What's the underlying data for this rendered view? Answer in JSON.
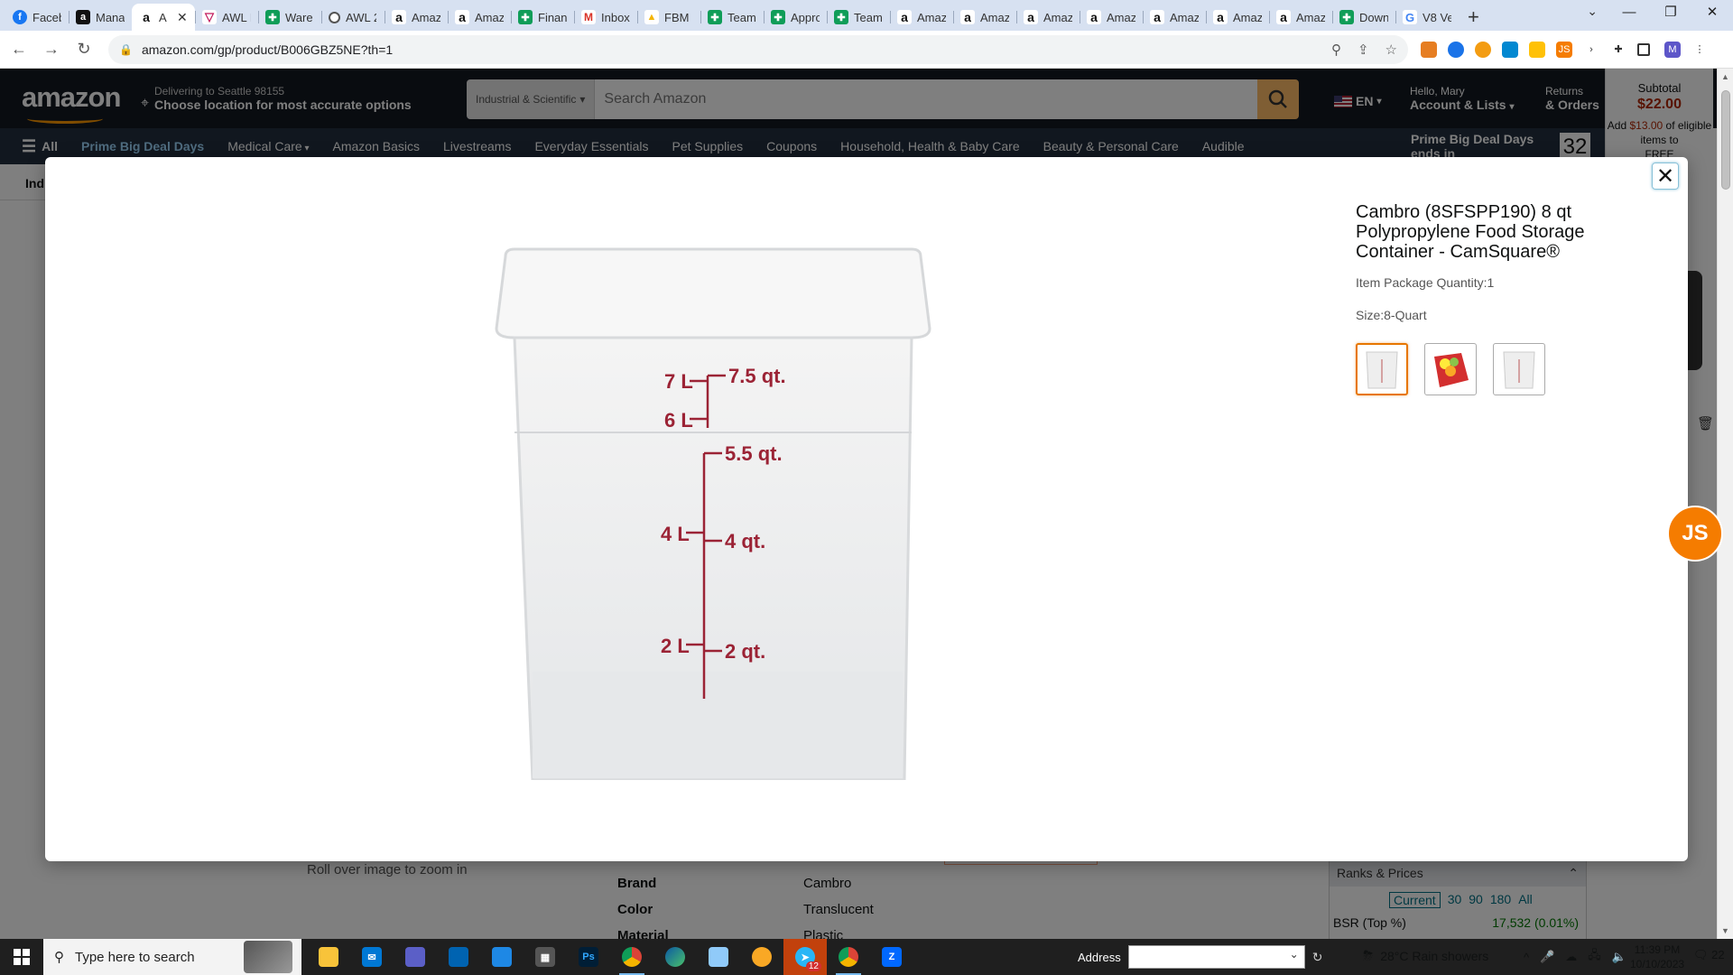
{
  "browser": {
    "tabs": [
      {
        "icon": "facebook",
        "title": "Faceb"
      },
      {
        "icon": "amazon-dark",
        "title": "Mana"
      },
      {
        "icon": "amazon",
        "title": "A",
        "active": true
      },
      {
        "icon": "awl",
        "title": "AWL L"
      },
      {
        "icon": "sheets",
        "title": "Ware"
      },
      {
        "icon": "globe",
        "title": "AWL 2"
      },
      {
        "icon": "amazon",
        "title": "Amaz"
      },
      {
        "icon": "amazon",
        "title": "Amaz"
      },
      {
        "icon": "sheets",
        "title": "Finan"
      },
      {
        "icon": "gmail",
        "title": "Inbox"
      },
      {
        "icon": "drive",
        "title": "FBM L"
      },
      {
        "icon": "sheets",
        "title": "Team"
      },
      {
        "icon": "sheets",
        "title": "Appro"
      },
      {
        "icon": "sheets",
        "title": "Team"
      },
      {
        "icon": "amazon",
        "title": "Amaz"
      },
      {
        "icon": "amazon",
        "title": "Amaz"
      },
      {
        "icon": "amazon",
        "title": "Amaz"
      },
      {
        "icon": "amazon",
        "title": "Amaz"
      },
      {
        "icon": "amazon",
        "title": "Amaz"
      },
      {
        "icon": "amazon",
        "title": "Amaz"
      },
      {
        "icon": "amazon",
        "title": "Amaz"
      },
      {
        "icon": "sheets",
        "title": "Down"
      },
      {
        "icon": "google",
        "title": "V8 Ve"
      }
    ],
    "url": "amazon.com/gp/product/B006GBZ5NE?th=1",
    "profile_initial": "M"
  },
  "amazon": {
    "logo": "amazon",
    "deliver_line1": "Delivering to Seattle 98155",
    "deliver_line2": "Choose location for most accurate options",
    "search_category": "Industrial & Scientific",
    "search_placeholder": "Search Amazon",
    "language": "EN",
    "account_line1": "Hello, Mary",
    "account_line2": "Account & Lists",
    "returns_line1": "Returns",
    "returns_line2": "& Orders",
    "subtotal_label": "Subtotal",
    "subtotal_value": "$22.00",
    "subtotal_add_prefix": "Add",
    "subtotal_add_amount": "$13.00",
    "subtotal_add_suffix": "of eligible items to",
    "subtotal_line_cut": "FREE",
    "nav_all": "All",
    "nav_items": [
      "Prime Big Deal Days",
      "Medical Care",
      "Amazon Basics",
      "Livestreams",
      "Everyday Essentials",
      "Pet Supplies",
      "Coupons",
      "Household, Health & Baby Care",
      "Beauty & Personal Care",
      "Audible"
    ],
    "nav_promo": "Prime Big Deal Days ends in",
    "nav_countdown": "32",
    "subnav_cut": "Ind",
    "roll_over": "Roll over image to zoom in",
    "specs": [
      {
        "k": "Brand",
        "v": "Cambro"
      },
      {
        "k": "Color",
        "v": "Translucent"
      },
      {
        "k": "Material",
        "v": "Plastic"
      }
    ],
    "ranks_title": "Ranks & Prices",
    "ranks_tabs": [
      "Current",
      "30",
      "90",
      "180",
      "All"
    ],
    "bsr_label": "BSR (Top %)",
    "bsr_value": "17,532 (0.01%)"
  },
  "modal": {
    "title": "Cambro (8SFSPP190) 8 qt Polypropylene Food Storage Container - CamSquare®",
    "package_qty": "Item Package Quantity:1",
    "size": "Size:8-Quart",
    "container_marks": {
      "left": [
        "7 L",
        "6 L",
        "4 L",
        "2 L"
      ],
      "right": [
        "7.5 qt.",
        "5.5 qt.",
        "4 qt.",
        "2 qt."
      ]
    },
    "mark_color": "#9b2335"
  },
  "js_badge": "JS",
  "taskbar": {
    "search_placeholder": "Type here to search",
    "address_label": "Address",
    "weather": "28°C  Rain showers",
    "time": "11:39 PM",
    "date": "10/10/2023",
    "notifications": "22",
    "badge_count": "12"
  }
}
